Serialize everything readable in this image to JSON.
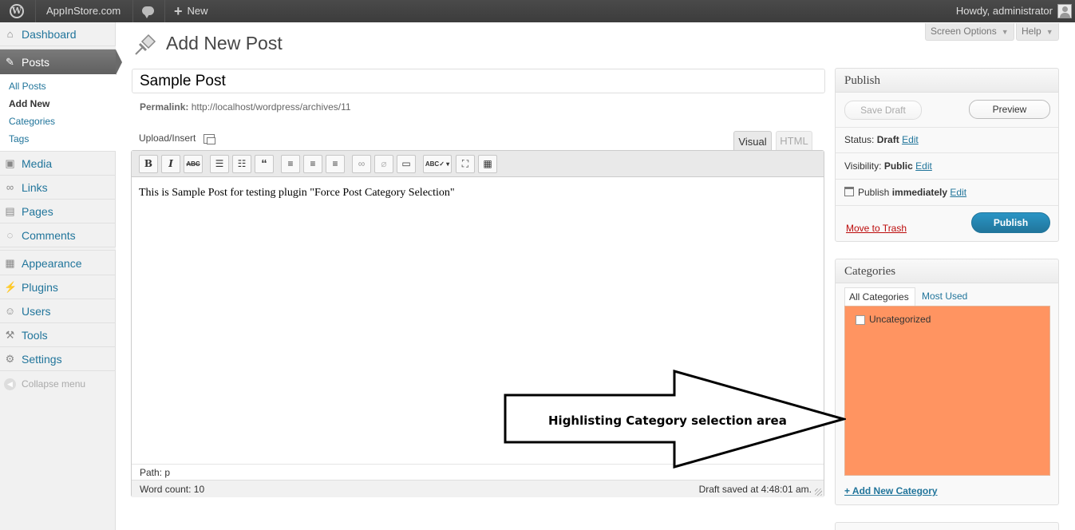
{
  "adminbar": {
    "site_name": "AppInStore.com",
    "new_label": "New",
    "howdy": "Howdy, administrator"
  },
  "sidebar": {
    "dashboard": "Dashboard",
    "posts": "Posts",
    "posts_submenu": [
      "All Posts",
      "Add New",
      "Categories",
      "Tags"
    ],
    "media": "Media",
    "links": "Links",
    "pages": "Pages",
    "comments": "Comments",
    "appearance": "Appearance",
    "plugins": "Plugins",
    "users": "Users",
    "tools": "Tools",
    "settings": "Settings",
    "collapse": "Collapse menu"
  },
  "screen_options": {
    "screen_options_label": "Screen Options",
    "help_label": "Help"
  },
  "main": {
    "page_title": "Add New Post",
    "post_title": "Sample Post",
    "permalink_label": "Permalink:",
    "permalink_url": "http://localhost/wordpress/archives/11",
    "upload_insert": "Upload/Insert",
    "tab_visual": "Visual",
    "tab_html": "HTML",
    "content": "This is Sample Post for testing plugin \"Force Post Category Selection\"",
    "path_label": "Path:",
    "path_value": "p",
    "word_count": "Word count: 10",
    "draft_saved": "Draft saved at 4:48:01 am."
  },
  "toolbar_buttons": [
    "B",
    "I",
    "ABC"
  ],
  "publish": {
    "title": "Publish",
    "save_draft": "Save Draft",
    "preview": "Preview",
    "status_label": "Status:",
    "status_value": "Draft",
    "visibility_label": "Visibility:",
    "visibility_value": "Public",
    "publish_label": "Publish",
    "publish_value": "immediately",
    "edit": "Edit",
    "move_to_trash": "Move to Trash",
    "publish_button": "Publish"
  },
  "categories": {
    "title": "Categories",
    "tab_all": "All Categories",
    "tab_most_used": "Most Used",
    "items": [
      "Uncategorized"
    ],
    "add_new": "+ Add New Category",
    "highlight_color": "#ff9461"
  },
  "annotation": {
    "text": "Highlisting Category selection area"
  }
}
